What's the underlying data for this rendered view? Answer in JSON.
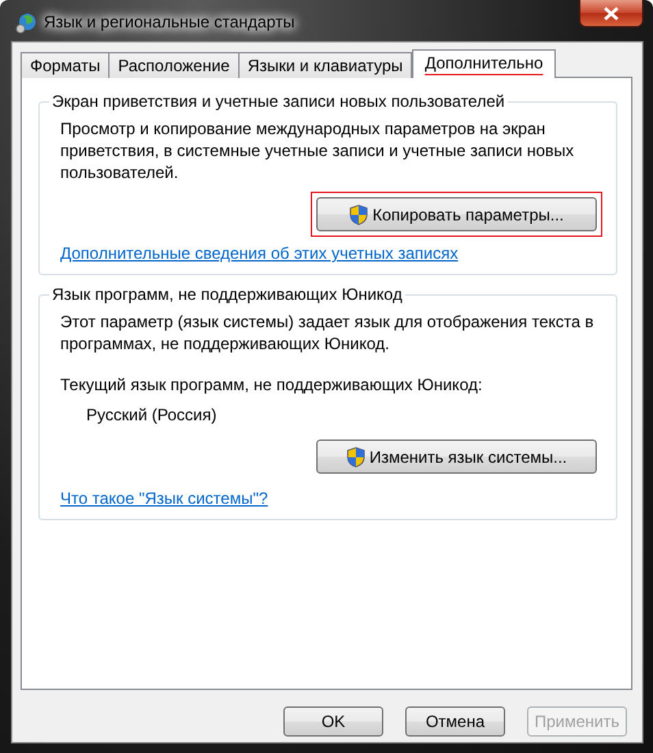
{
  "window": {
    "title": "Язык и региональные стандарты"
  },
  "tabs": [
    {
      "label": "Форматы",
      "selected": false,
      "highlighted": false
    },
    {
      "label": "Расположение",
      "selected": false,
      "highlighted": false
    },
    {
      "label": "Языки и клавиатуры",
      "selected": false,
      "highlighted": false
    },
    {
      "label": "Дополнительно",
      "selected": true,
      "highlighted": true
    }
  ],
  "groups": [
    {
      "title": "Экран приветствия и учетные записи новых пользователей",
      "items": [
        {
          "kind": "text",
          "text": "Просмотр и копирование международных параметров на экран приветствия, в системные учетные записи и учетные записи новых пользователей."
        },
        {
          "kind": "button",
          "label": "Копировать параметры...",
          "shield": true,
          "highlighted": true
        },
        {
          "kind": "link",
          "text": "Дополнительные сведения об этих учетных записях"
        }
      ]
    },
    {
      "title": "Язык программ, не поддерживающих Юникод",
      "items": [
        {
          "kind": "text",
          "text": "Этот параметр (язык системы) задает язык для отображения текста в программах, не поддерживающих Юникод."
        },
        {
          "kind": "label",
          "text": "Текущий язык программ, не поддерживающих Юникод:"
        },
        {
          "kind": "value",
          "text": "Русский (Россия)"
        },
        {
          "kind": "button",
          "label": "Изменить язык системы...",
          "shield": true,
          "highlighted": false
        },
        {
          "kind": "link",
          "text": "Что такое \"Язык системы\"?"
        }
      ]
    }
  ],
  "buttons": [
    {
      "label": "OK",
      "disabled": false
    },
    {
      "label": "Отмена",
      "disabled": false
    },
    {
      "label": "Применить",
      "disabled": true
    }
  ]
}
